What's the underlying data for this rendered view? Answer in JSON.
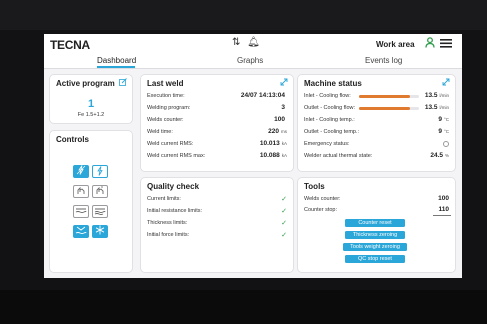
{
  "header": {
    "logo": "TECNA",
    "sort_icon": "⇅",
    "bell_icon": "🔔︎",
    "workarea_label": "Work area",
    "user_icon": "user-icon",
    "menu_icon": "≡"
  },
  "tabs": [
    {
      "label": "Dashboard",
      "active": true
    },
    {
      "label": "Graphs",
      "active": false
    },
    {
      "label": "Events log",
      "active": false
    }
  ],
  "active_program": {
    "title": "Active program",
    "number": "1",
    "subtitle": "Fe 1.5+1.2"
  },
  "controls": {
    "title": "Controls"
  },
  "last_weld": {
    "title": "Last weld",
    "rows": [
      {
        "label": "Execution time:",
        "value": "24/07 14:13:04",
        "unit": ""
      },
      {
        "label": "Welding program:",
        "value": "3",
        "unit": ""
      },
      {
        "label": "Welds counter:",
        "value": "100",
        "unit": ""
      },
      {
        "label": "Weld time:",
        "value": "220",
        "unit": "ms"
      },
      {
        "label": "Weld current RMS:",
        "value": "10.013",
        "unit": "kA"
      },
      {
        "label": "Weld current RMS max:",
        "value": "10.088",
        "unit": "kA"
      }
    ]
  },
  "machine_status": {
    "title": "Machine status",
    "rows": [
      {
        "label": "Inlet - Cooling flow:",
        "value": "13.5",
        "unit": "l/min",
        "bar_fraction": 0.85
      },
      {
        "label": "Outlet - Cooling flow:",
        "value": "13.5",
        "unit": "l/min",
        "bar_fraction": 0.85
      },
      {
        "label": "Inlet - Cooling temp.:",
        "value": "9",
        "unit": "°C"
      },
      {
        "label": "Outlet - Cooling temp.:",
        "value": "9",
        "unit": "°C"
      },
      {
        "label": "Emergency status:",
        "value": "",
        "unit": ""
      },
      {
        "label": "Welder actual thermal state:",
        "value": "24.5",
        "unit": "%"
      }
    ],
    "accent_color": "#e07a2e"
  },
  "quality_check": {
    "title": "Quality check",
    "rows": [
      {
        "label": "Current limits:"
      },
      {
        "label": "Initial resistance limits:"
      },
      {
        "label": "Thickness limits:"
      },
      {
        "label": "Initial force limits:"
      }
    ],
    "check_symbol": "✓"
  },
  "tools": {
    "title": "Tools",
    "welds_counter_label": "Welds counter:",
    "welds_counter_value": "100",
    "counter_stop_label": "Counter stop:",
    "counter_stop_value": "110",
    "buttons": [
      "Counter reset",
      "Thickness zeroing",
      "Tools weight zeroing",
      "QC stop reset"
    ]
  },
  "colors": {
    "accent": "#2aa6d8",
    "ok": "#2e9c4b"
  }
}
